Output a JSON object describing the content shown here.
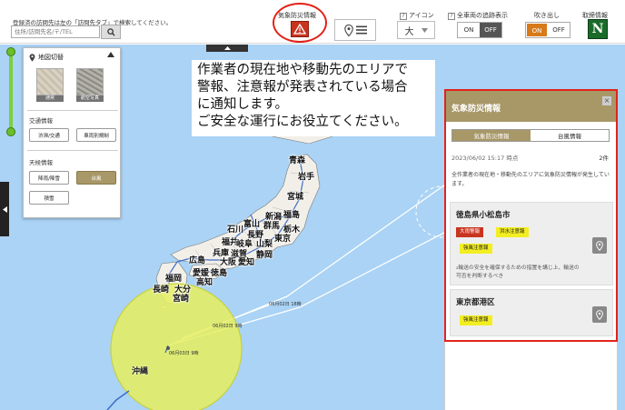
{
  "toolbar": {
    "search_hint": "登録済の訪問先は左の「訪問先タブ」で検索してください。",
    "search_placeholder": "住所/訪問先名/〒/TEL",
    "weather_label": "気象防災情報",
    "icon_label": "アイコン",
    "icon_size_value": "大",
    "track_label": "全車両の追跡表示",
    "track_on": "ON",
    "track_off": "OFF",
    "balloon_label": "吹き出し",
    "balloon_on": "ON",
    "balloon_off": "OFF",
    "traffic_label": "取締情報",
    "traffic_value": "N",
    "help_mark": "?"
  },
  "layer_panel": {
    "title": "地図切替",
    "map_types": [
      "通常",
      "航空写真"
    ],
    "traffic_section": "交通情報",
    "traffic_buttons": [
      "渋滞/交通",
      "車両別規制"
    ],
    "weather_section": "天候情報",
    "weather_buttons": [
      "降雨/降雪",
      "台風",
      "積雪"
    ]
  },
  "notice": {
    "lines": [
      "作業者の現在地や移動先のエリアで",
      "警報、注意報が発表されている場合",
      "に通知します。",
      "ご安全な運行にお役立てください。"
    ]
  },
  "map": {
    "labels": [
      "青森",
      "岩手",
      "宮城",
      "福島",
      "新潟",
      "富山",
      "群馬",
      "石川",
      "長野",
      "福井",
      "栃木",
      "東京",
      "岐阜",
      "山梨",
      "滋賀",
      "静岡",
      "愛知",
      "兵庫",
      "大阪",
      "広島",
      "愛媛",
      "徳島",
      "高知",
      "福岡",
      "長崎",
      "大分",
      "宮崎",
      "沖縄"
    ],
    "typhoon_times": [
      "06月02日 18時",
      "06月02日 9時",
      "06月03日 9時"
    ],
    "colors": {
      "sea": "#aad3f5",
      "land": "#f2efe9",
      "typhoon": "#e6ef5e"
    }
  },
  "weather_panel": {
    "title": "気象防災情報",
    "close": "×",
    "tabs": [
      "気象防災情報",
      "台風情報"
    ],
    "updated": "2023/06/02 15:17 時点",
    "count": "2件",
    "description": "全作業者の現在地・移動先のエリアに気象防災情報が発生しています。",
    "areas": [
      {
        "name": "徳島県小松島市",
        "badges": [
          "大雨警報",
          "洪水注意報",
          "強風注意報"
        ],
        "text": "₂輸送の安全を確保するための措置を講じ上、輸送の可否を判断するべき"
      },
      {
        "name": "東京都港区",
        "badges": [
          "強風注意報"
        ],
        "text": ""
      }
    ]
  }
}
